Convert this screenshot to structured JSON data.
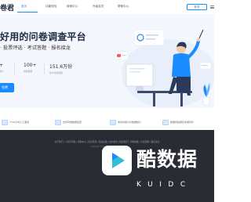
{
  "nav": {
    "logo": "卷君",
    "items": [
      {
        "label": "首页",
        "active": true
      },
      {
        "label": "功能特性",
        "active": false
      },
      {
        "label": "使用中心",
        "active": false
      },
      {
        "label": "升级会员",
        "active": false
      },
      {
        "label": "帮助中心",
        "active": false
      }
    ],
    "login_label": "登录"
  },
  "hero": {
    "headline": "好用的问卷调查平台",
    "subline": "· 投票评选 · 考试答题 · 报名接龙",
    "stats": [
      {
        "value": "+",
        "label": "用户"
      },
      {
        "value": "100+",
        "label": "模板数量"
      },
      {
        "value": "151.6万份",
        "label": "累计收集数据"
      }
    ],
    "cta_label": "免费"
  },
  "features": [
    {
      "icon": "support-icon",
      "label": "7*24小时人工服务"
    },
    {
      "icon": "shield-icon",
      "label": "支持问卷数据加密"
    },
    {
      "icon": "chart-icon",
      "label": "支持内容分享数据统计"
    },
    {
      "icon": "devices-icon",
      "label": "数据持续保存多端同步"
    }
  ],
  "footer": {
    "links": "关于我们 | 小程序问卷 | 帮助中心 | 投票评选 | 隐私政策 | 用户协议 | 联系我们 | 问卷模板 | 考试答题 | 报名接龙",
    "copyright": "Copyright © 2024 卷君问卷 版权所有"
  },
  "watermark": {
    "title": "酷数据",
    "subtitle": "KUIDC"
  },
  "colors": {
    "accent": "#1a8cff",
    "hero_bg": "#f4f7fd",
    "footer_bg": "#2a2c34",
    "heading": "#1f2a44"
  }
}
